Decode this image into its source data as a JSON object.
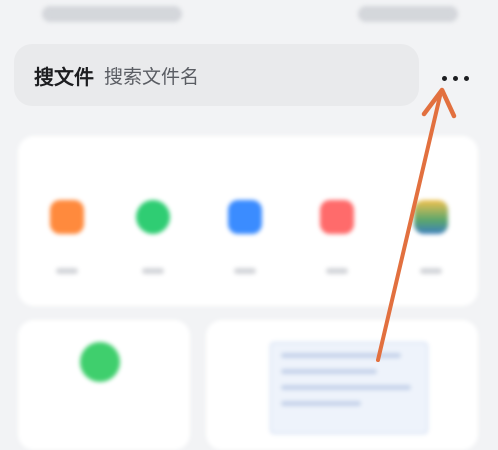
{
  "search": {
    "label": "搜文件",
    "placeholder": "搜索文件名"
  },
  "more_button": {
    "icon": "more-dots-icon"
  },
  "apps_card": {
    "title": "",
    "link": "",
    "apps": [
      {
        "name": "",
        "icon": "orange-app-icon",
        "color": "#ff8a3d"
      },
      {
        "name": "",
        "icon": "green-app-icon",
        "color": "#2fcd73"
      },
      {
        "name": "",
        "icon": "blue-app-icon",
        "color": "#3b8cff"
      },
      {
        "name": "",
        "icon": "red-app-icon",
        "color": "#ff6b6b"
      },
      {
        "name": "",
        "icon": "photo-app-icon",
        "color": "#5aa66d"
      }
    ]
  },
  "storage_card": {
    "label": "",
    "size": "",
    "color": "#3fcf6d"
  },
  "annotation": {
    "arrow_color": "#e2703f"
  }
}
